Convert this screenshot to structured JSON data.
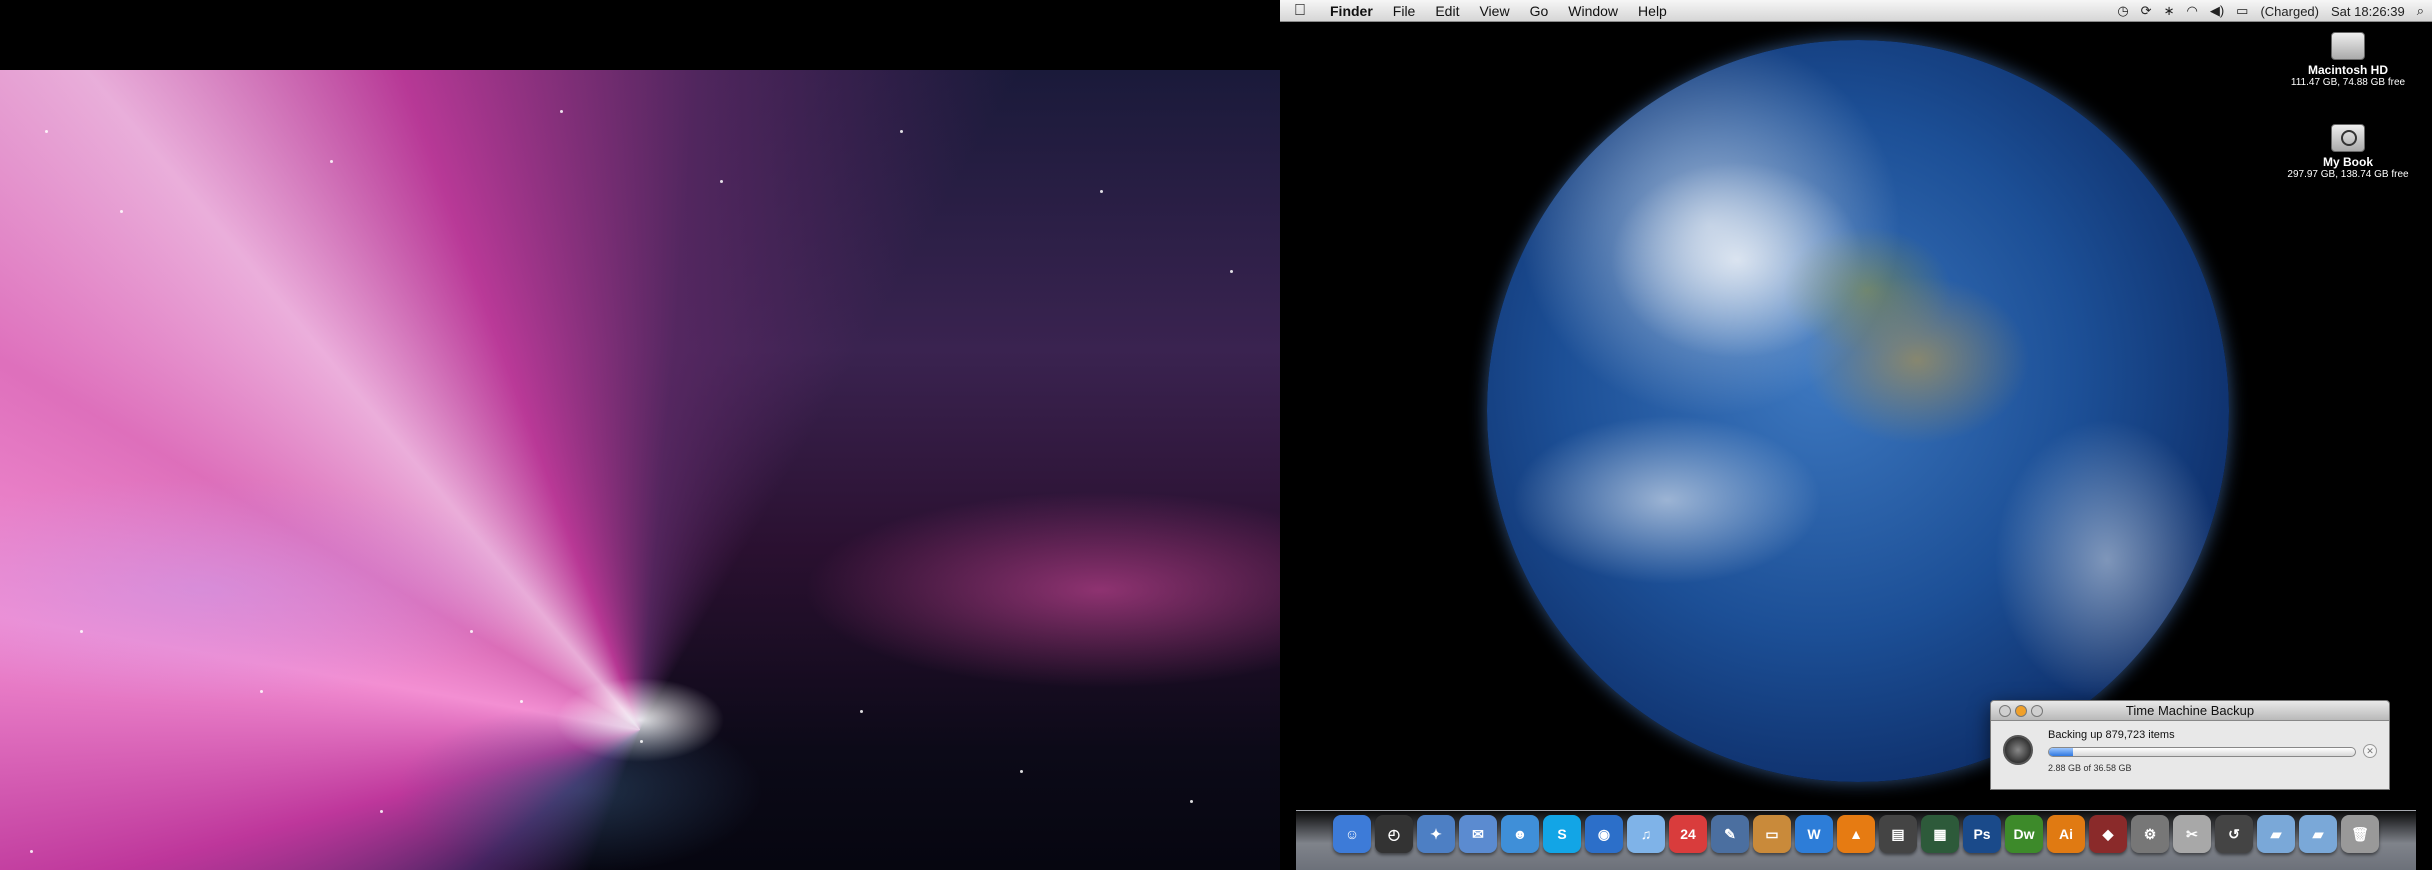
{
  "menubar": {
    "apple_icon": "apple-icon",
    "app_name": "Finder",
    "menus": [
      "File",
      "Edit",
      "View",
      "Go",
      "Window",
      "Help"
    ],
    "status_items": [
      "time-machine-icon",
      "sync-icon",
      "bluetooth-icon",
      "wifi-icon",
      "volume-icon",
      "battery-icon"
    ],
    "battery_text": "(Charged)",
    "clock": "Sat 18:26:39",
    "spotlight_icon": "spotlight-icon"
  },
  "desktop": {
    "icons": [
      {
        "title": "Macintosh HD",
        "sub": "111.47 GB, 74.88 GB free",
        "icon": "hard-drive-icon"
      },
      {
        "title": "My Book",
        "sub": "297.97 GB, 138.74 GB free",
        "icon": "time-machine-drive-icon"
      }
    ]
  },
  "time_machine": {
    "title": "Time Machine Backup",
    "status": "Backing up 879,723 items",
    "progress_fraction": 0.08,
    "detail": "2.88 GB of 36.58 GB",
    "cancel_glyph": "✕"
  },
  "dock": {
    "items": [
      {
        "name": "finder-icon",
        "glyph": "☺",
        "color": "#3d7bd8"
      },
      {
        "name": "dashboard-icon",
        "glyph": "◴",
        "color": "#333333"
      },
      {
        "name": "safari-icon",
        "glyph": "✦",
        "color": "#4d7fc4"
      },
      {
        "name": "mail-icon",
        "glyph": "✉",
        "color": "#5b8bd0"
      },
      {
        "name": "ichat-contacts-icon",
        "glyph": "☻",
        "color": "#3f8fd8"
      },
      {
        "name": "skype-icon",
        "glyph": "S",
        "color": "#12a5e6"
      },
      {
        "name": "ichat-icon",
        "glyph": "◉",
        "color": "#2c6fc9"
      },
      {
        "name": "itunes-icon",
        "glyph": "♫",
        "color": "#7fb3e8"
      },
      {
        "name": "ical-icon",
        "glyph": "24",
        "color": "#d93c3c"
      },
      {
        "name": "pen-tool-icon",
        "glyph": "✎",
        "color": "#4b6fa0"
      },
      {
        "name": "presentation-icon",
        "glyph": "▭",
        "color": "#c98a3a"
      },
      {
        "name": "utility-blue-icon",
        "glyph": "W",
        "color": "#2d7dd8"
      },
      {
        "name": "vlc-icon",
        "glyph": "▲",
        "color": "#e67b12"
      },
      {
        "name": "clapperboard-icon",
        "glyph": "▤",
        "color": "#444444"
      },
      {
        "name": "movie-editor-icon",
        "glyph": "▦",
        "color": "#2d5a3a"
      },
      {
        "name": "photoshop-icon",
        "glyph": "Ps",
        "color": "#1a4a8a"
      },
      {
        "name": "dreamweaver-icon",
        "glyph": "Dw",
        "color": "#3d8a2a"
      },
      {
        "name": "illustrator-icon",
        "glyph": "Ai",
        "color": "#e07a12"
      },
      {
        "name": "app-red-icon",
        "glyph": "◆",
        "color": "#8a2a2a"
      },
      {
        "name": "system-preferences-icon",
        "glyph": "⚙",
        "color": "#777777"
      },
      {
        "name": "script-icon",
        "glyph": "✂",
        "color": "#a8a8a8"
      },
      {
        "name": "time-machine-icon",
        "glyph": "↺",
        "color": "#444444"
      },
      {
        "name": "applications-folder-icon",
        "glyph": "▰",
        "color": "#7aa8d8"
      },
      {
        "name": "documents-folder-icon",
        "glyph": "▰",
        "color": "#7aa8d8"
      },
      {
        "name": "trash-icon",
        "glyph": "🗑",
        "color": "#999999"
      }
    ]
  }
}
